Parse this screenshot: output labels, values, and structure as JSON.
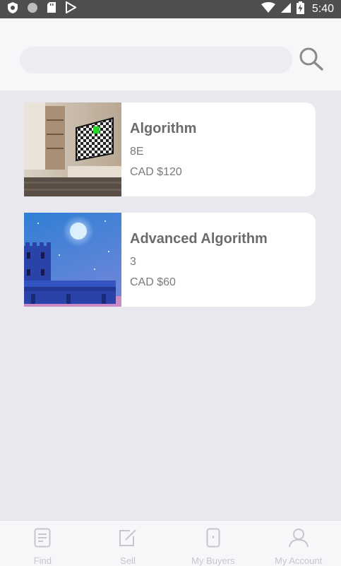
{
  "status_bar": {
    "time": "5:40",
    "icons": [
      "shield-icon",
      "circle-icon",
      "sd-card-icon",
      "play-store-icon",
      "wifi-icon",
      "signal-icon",
      "battery-charging-icon"
    ]
  },
  "search": {
    "placeholder": "",
    "value": "",
    "button_icon": "search-icon"
  },
  "listings": [
    {
      "title": "Algorithm",
      "subtitle": "8E",
      "price": "CAD $120",
      "thumbnail": "living-room-tv-image"
    },
    {
      "title": "Advanced Algorithm",
      "subtitle": "3",
      "price": "CAD $60",
      "thumbnail": "night-castle-image"
    }
  ],
  "tabs": [
    {
      "label": "Find",
      "icon": "document-icon"
    },
    {
      "label": "Sell",
      "icon": "edit-icon"
    },
    {
      "label": "My Buyers",
      "icon": "phone-icon"
    },
    {
      "label": "My Account",
      "icon": "user-icon"
    }
  ],
  "colors": {
    "status_bar": "#4e4e4e",
    "background": "#e8e8ee",
    "card": "#ffffff",
    "title_text": "#6b6b6b",
    "tab_inactive": "#c6c6cc"
  }
}
